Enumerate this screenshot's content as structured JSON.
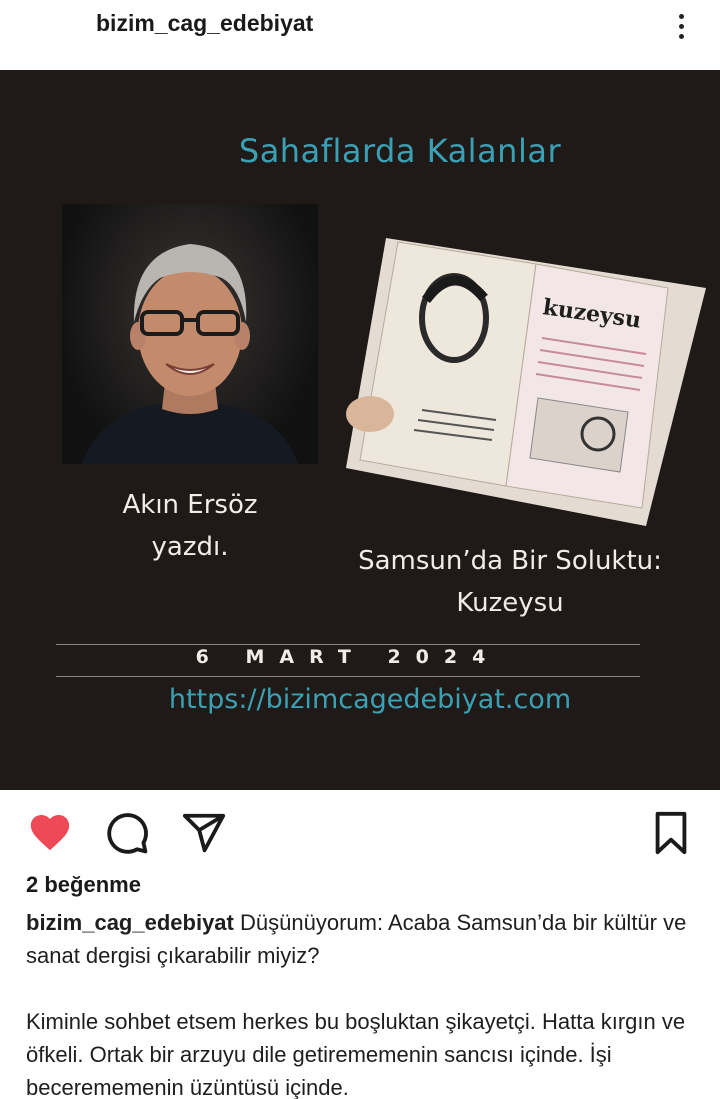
{
  "header": {
    "username": "bizim_cag_edebiyat",
    "more_icon": "more-vertical-icon"
  },
  "post": {
    "title": "Sahaflarda Kalanlar",
    "author_name": "Akın Ersöz",
    "author_verb": "yazdı.",
    "article_title_line1": "Samsun’da Bir Soluktu:",
    "article_title_line2": "Kuzeysu",
    "date": "6 MART 2024",
    "link": "https://bizimcagedebiyat.com",
    "magazine_name": "kuzeysu",
    "accent_color": "#3aa0b4",
    "background_color": "#1f1a18"
  },
  "actions": {
    "like_icon": "heart-filled-icon",
    "comment_icon": "comment-icon",
    "share_icon": "send-icon",
    "save_icon": "bookmark-icon",
    "like_color": "#ed4956"
  },
  "likes": {
    "text": "2 beğenme"
  },
  "caption": {
    "user": "bizim_cag_edebiyat",
    "paragraph1": "Düşünüyorum: Acaba Samsun’da bir kültür ve sanat dergisi çıkarabilir miyiz?",
    "paragraph2": "Kiminle sohbet etsem herkes bu boşluktan şikayetçi. Hatta kırgın ve öfkeli. Ortak bir arzuyu dile getirememenin sancısı içinde. İşi becerememenin üzüntüsü içinde."
  }
}
